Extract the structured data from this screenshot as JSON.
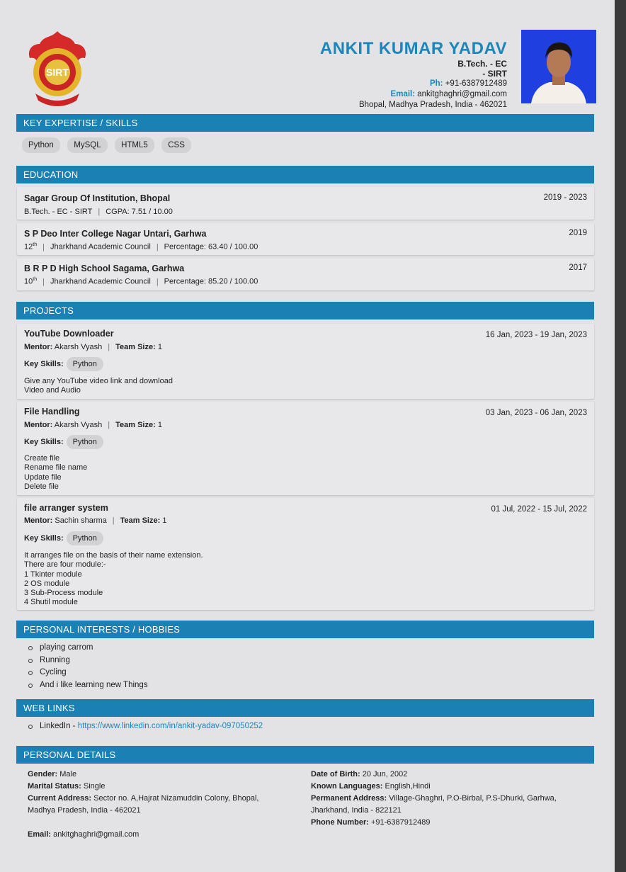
{
  "header": {
    "name": "ANKIT KUMAR YADAV",
    "degree_line1": "B.Tech. - EC",
    "degree_line2": "- SIRT",
    "phone_label": "Ph:",
    "phone": "+91-6387912489",
    "email_label": "Email:",
    "email": "ankitghaghri@gmail.com",
    "address": "Bhopal, Madhya Pradesh, India - 462021",
    "logo_text": "SIRT"
  },
  "sections": {
    "skills": "KEY EXPERTISE / SKILLS",
    "education": "EDUCATION",
    "projects": "PROJECTS",
    "hobbies": "PERSONAL INTERESTS / HOBBIES",
    "weblinks": "WEB LINKS",
    "personal": "PERSONAL DETAILS"
  },
  "skills": [
    "Python",
    "MySQL",
    "HTML5",
    "CSS"
  ],
  "education": [
    {
      "title": "Sagar Group Of Institution, Bhopal",
      "date": "2019 - 2023",
      "part1": "B.Tech. - EC - SIRT",
      "part2": "CGPA: 7.51 / 10.00"
    },
    {
      "title": "S P Deo Inter College Nagar Untari, Garhwa",
      "date": "2019",
      "grade": "12",
      "sup": "th",
      "board": "Jharkhand Academic Council",
      "score": "Percentage: 63.40 / 100.00"
    },
    {
      "title": "B R P D High School Sagama, Garhwa",
      "date": "2017",
      "grade": "10",
      "sup": "th",
      "board": "Jharkhand Academic Council",
      "score": "Percentage: 85.20 / 100.00"
    }
  ],
  "projects": [
    {
      "title": "YouTube Downloader",
      "date": "16 Jan, 2023 - 19 Jan, 2023",
      "mentor_label": "Mentor:",
      "mentor": "Akarsh Vyash",
      "team_label": "Team Size:",
      "team": "1",
      "key_label": "Key Skills:",
      "skill": "Python",
      "desc": "Give any YouTube video link and download\nVideo and Audio"
    },
    {
      "title": "File Handling",
      "date": "03 Jan, 2023 - 06 Jan, 2023",
      "mentor_label": "Mentor:",
      "mentor": "Akarsh Vyash",
      "team_label": "Team Size:",
      "team": "1",
      "key_label": "Key Skills:",
      "skill": "Python",
      "desc": "Create file\nRename file name\nUpdate file\nDelete file"
    },
    {
      "title": "file arranger system",
      "date": "01 Jul, 2022 - 15 Jul, 2022",
      "mentor_label": "Mentor:",
      "mentor": "Sachin sharma",
      "team_label": "Team Size:",
      "team": "1",
      "key_label": "Key Skills:",
      "skill": "Python",
      "desc": "It arranges file on the basis of their name extension.\nThere are four module:-\n1 Tkinter module\n2 OS module\n3 Sub-Process module\n4 Shutil module"
    }
  ],
  "hobbies": [
    "playing carrom",
    "Running",
    "Cycling",
    "And i like learning new Things"
  ],
  "weblinks": {
    "label": "LinkedIn - ",
    "url": "https://www.linkedin.com/in/ankit-yadav-097050252"
  },
  "personal": {
    "gender_label": "Gender:",
    "gender": "Male",
    "marital_label": "Marital Status:",
    "marital": "Single",
    "current_label": "Current Address:",
    "current": "Sector no. A,Hajrat Nizamuddin Colony, Bhopal,",
    "current2": "Madhya Pradesh, India - 462021",
    "email_label": "Email:",
    "email": "ankitghaghri@gmail.com",
    "dob_label": "Date of Birth:",
    "dob": "20 Jun, 2002",
    "lang_label": "Known Languages:",
    "lang": "English,Hindi",
    "perm_label": "Permanent Address:",
    "perm": "Village-Ghaghri, P.O-Birbal, P.S-Dhurki, Garhwa,",
    "perm2": "Jharkhand, India - 822121",
    "phone_label": "Phone Number:",
    "phone": "+91-6387912489"
  }
}
